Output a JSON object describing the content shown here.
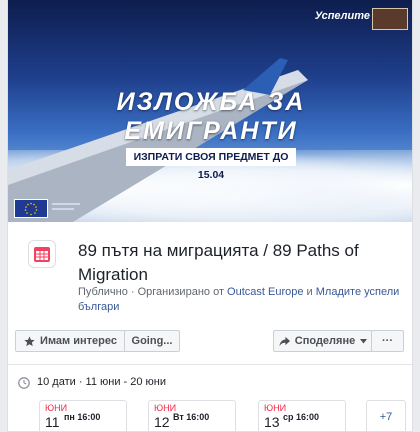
{
  "cover": {
    "brand": "Успелите",
    "headline_line1": "ИЗЛОЖБА ЗА",
    "headline_line2": "ЕМИГРАНТИ",
    "tagline": "ИЗПРАТИ СВОЯ ПРЕДМЕТ ДО 15.04"
  },
  "event": {
    "title": "89 пътя на миграцията / 89 Paths of Migration",
    "privacy": "Публично",
    "organized_by": "· Организирано от",
    "organizer_1": "Outcast Europe",
    "and": "и",
    "organizer_2": "Младите успели българи"
  },
  "actions": {
    "interested_label": "Имам интерес",
    "going_label": "Going...",
    "share_label": "Споделяне",
    "more_label": "···"
  },
  "dates": {
    "summary": "10 дати · 11 юни - 20 юни",
    "items": [
      {
        "month": "ЮНИ",
        "day": "11",
        "time": "пн 16:00"
      },
      {
        "month": "ЮНИ",
        "day": "12",
        "time": "Вт 16:00"
      },
      {
        "month": "ЮНИ",
        "day": "13",
        "time": "ср 16:00"
      }
    ],
    "more": "+7"
  },
  "colors": {
    "link": "#385898",
    "date_red": "#f02849",
    "calendar_red": "#f3425f",
    "button_bg": "#f5f6f7"
  },
  "icons": {
    "calendar": "calendar-icon",
    "star": "star-icon",
    "share": "share-arrow-icon",
    "clock": "clock-icon"
  }
}
